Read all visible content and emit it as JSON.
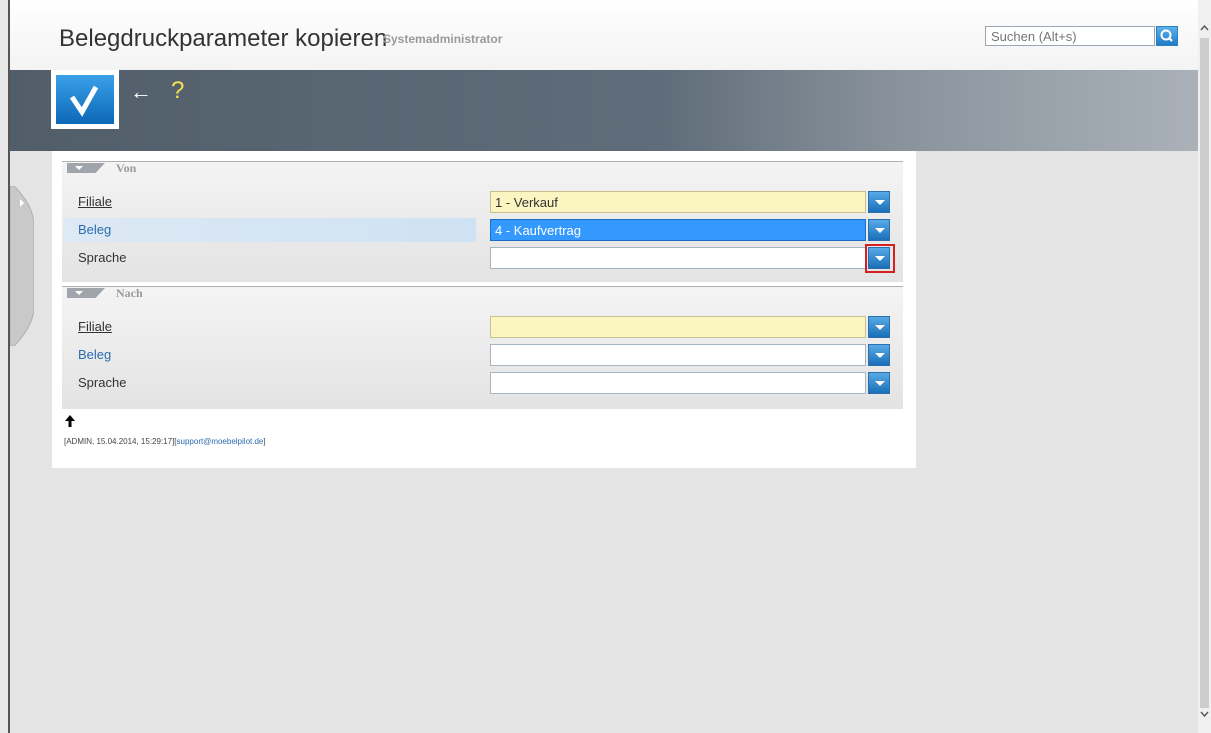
{
  "header": {
    "title": "Belegdruckparameter kopieren",
    "subtitle": "Systemadministrator",
    "search_placeholder": "Suchen (Alt+s)"
  },
  "toolbar": {
    "back_symbol": "←",
    "help_symbol": "?"
  },
  "sections": {
    "von": {
      "title": "Von",
      "filiale_label": "Filiale",
      "filiale_value": "1 - Verkauf",
      "beleg_label": "Beleg",
      "beleg_value": "4 - Kaufvertrag",
      "sprache_label": "Sprache",
      "sprache_value": ""
    },
    "nach": {
      "title": "Nach",
      "filiale_label": "Filiale",
      "filiale_value": "",
      "beleg_label": "Beleg",
      "beleg_value": "",
      "sprache_label": "Sprache",
      "sprache_value": ""
    }
  },
  "footer": {
    "up_symbol": "🠕",
    "info_prefix": "[ADMIN, 15.04.2014, 15:29:17][",
    "info_email": "support@moebelpilot.de",
    "info_suffix": "]"
  },
  "colors": {
    "accent": "#1f7bc4",
    "toolbar": "#5f6d7a",
    "required_field": "#fbf5c2",
    "selection": "#3399ff",
    "highlight_border": "#d42020"
  }
}
